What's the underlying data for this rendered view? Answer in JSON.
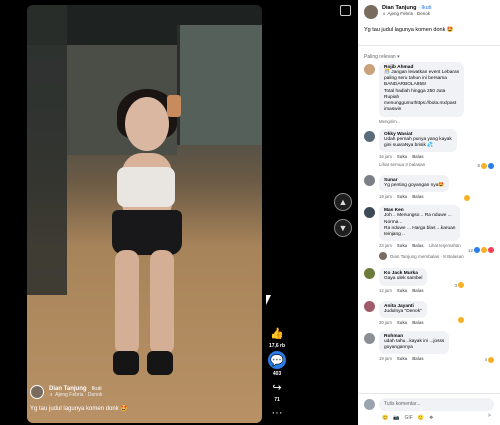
{
  "video": {
    "author": "Dian Tanjung",
    "follow": "Ikuti",
    "music": "♬ Ajeng Febria · Denok",
    "caption": "Yg tau judul lagunya komen donk 🤩",
    "actions": [
      {
        "icon": "like-icon",
        "count": "17,6 rb"
      },
      {
        "icon": "comment-icon",
        "count": "403"
      },
      {
        "icon": "share-icon",
        "count": "71"
      }
    ],
    "more": "···"
  },
  "panel": {
    "author": "Dian Tanjung",
    "follow": "· Ikuti",
    "music": "♬ Ajeng Febria · Denok",
    "caption": "Yg tau judul lagunya komen donk 🤩",
    "sort": "Paling relevan ▾"
  },
  "comments": [
    {
      "name": "Rojib Ahmad",
      "text": "🎊 Jangan lewatkan event Lebaran\npaling seru tahun ini bersama\nBANDARBOLA855!\nTotal hadiah hingga 250 Juta\nRupiah\nmenunggumu!https://bola.mx/past\nimaswin",
      "meta": [
        "Mengirim..."
      ],
      "avatar": "#c9a27a"
    },
    {
      "name": "Okky Wasiat",
      "text": "Udah pernah punya yang kayak\ngini suaraNya brisik 💦",
      "meta": [
        "16 jam",
        "Suka",
        "Balas"
      ],
      "react": "5",
      "avatar": "#5a6b7a",
      "more": "Lihat semua 3 balasan"
    },
    {
      "name": "Sunar",
      "text": "Yg penting goyangan nya🤩",
      "meta": [
        "19 jam",
        "Suka",
        "Balas"
      ],
      "avatar": "#7b7f86"
    },
    {
      "name": "Mas Ken",
      "text": "Joh .. Menungso .. Ra nduwe ...\nNorma ..\nRa nduwe ... Harga blas ...karuan\nteinjang ..",
      "meta": [
        "23 jam",
        "Suka",
        "Balas",
        "Lihat terjemahan"
      ],
      "react": "12",
      "avatar": "#3d4a58",
      "reply": "Dian Tanjung membalas · 8 Balasan"
    },
    {
      "name": "Ko Jack Murka",
      "text": "Gaya ulek sambel",
      "meta": [
        "12 jam",
        "Suka",
        "Balas"
      ],
      "react": "3",
      "avatar": "#6a7b3a"
    },
    {
      "name": "Anita Jayanti",
      "text": "Judulnya \"Denok\"",
      "meta": [
        "20 jam",
        "Suka",
        "Balas"
      ],
      "avatar": "#a05a6a"
    },
    {
      "name": "Rohman",
      "text": "udah tahu...kayak ini ...josss\ngoyangannya",
      "meta": [
        "19 jam",
        "Suka",
        "Balas"
      ],
      "react": "4",
      "avatar": "#8a8f96"
    }
  ],
  "composer": {
    "placeholder": "Tulis komentar...",
    "icons": [
      "😊",
      "📷",
      "GIF",
      "🙂",
      "❖"
    ],
    "send": "➤"
  },
  "colors": {
    "accent": "#1877f2",
    "like": "#2b7de9",
    "love": "#f33e58",
    "haha": "#f7b125"
  }
}
